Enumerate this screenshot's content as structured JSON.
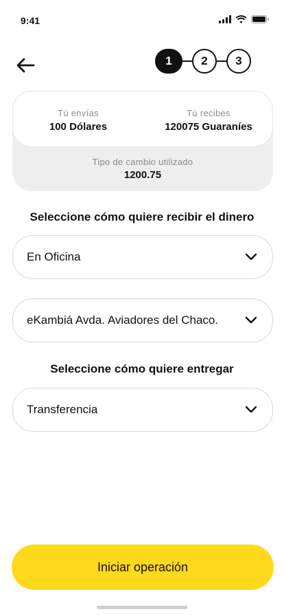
{
  "status_bar": {
    "time": "9:41"
  },
  "stepper": {
    "steps": [
      "1",
      "2",
      "3"
    ],
    "active": 1
  },
  "summary": {
    "send_label": "Tú envías",
    "send_value": "100 Dólares",
    "receive_label": "Tú recibes",
    "receive_value": "120075 Guaraníes",
    "rate_label": "Tipo de cambio utilizado",
    "rate_value": "1200.75"
  },
  "receive_section": {
    "title": "Seleccione cómo quiere recibir el dinero",
    "method_select": "En Oficina",
    "office_select": "eKambiá Avda. Aviadores del Chaco."
  },
  "deliver_section": {
    "title": "Seleccione cómo quiere entregar",
    "method_select": "Transferencia"
  },
  "cta": {
    "label": "Iniciar operación"
  },
  "colors": {
    "accent": "#FFD91C",
    "card_bg": "#EEEEEF",
    "text": "#111111",
    "muted": "#8A8A8A"
  },
  "icons": [
    "back-arrow-icon",
    "chevron-down-icon",
    "signal-icon",
    "wifi-icon",
    "battery-icon"
  ]
}
